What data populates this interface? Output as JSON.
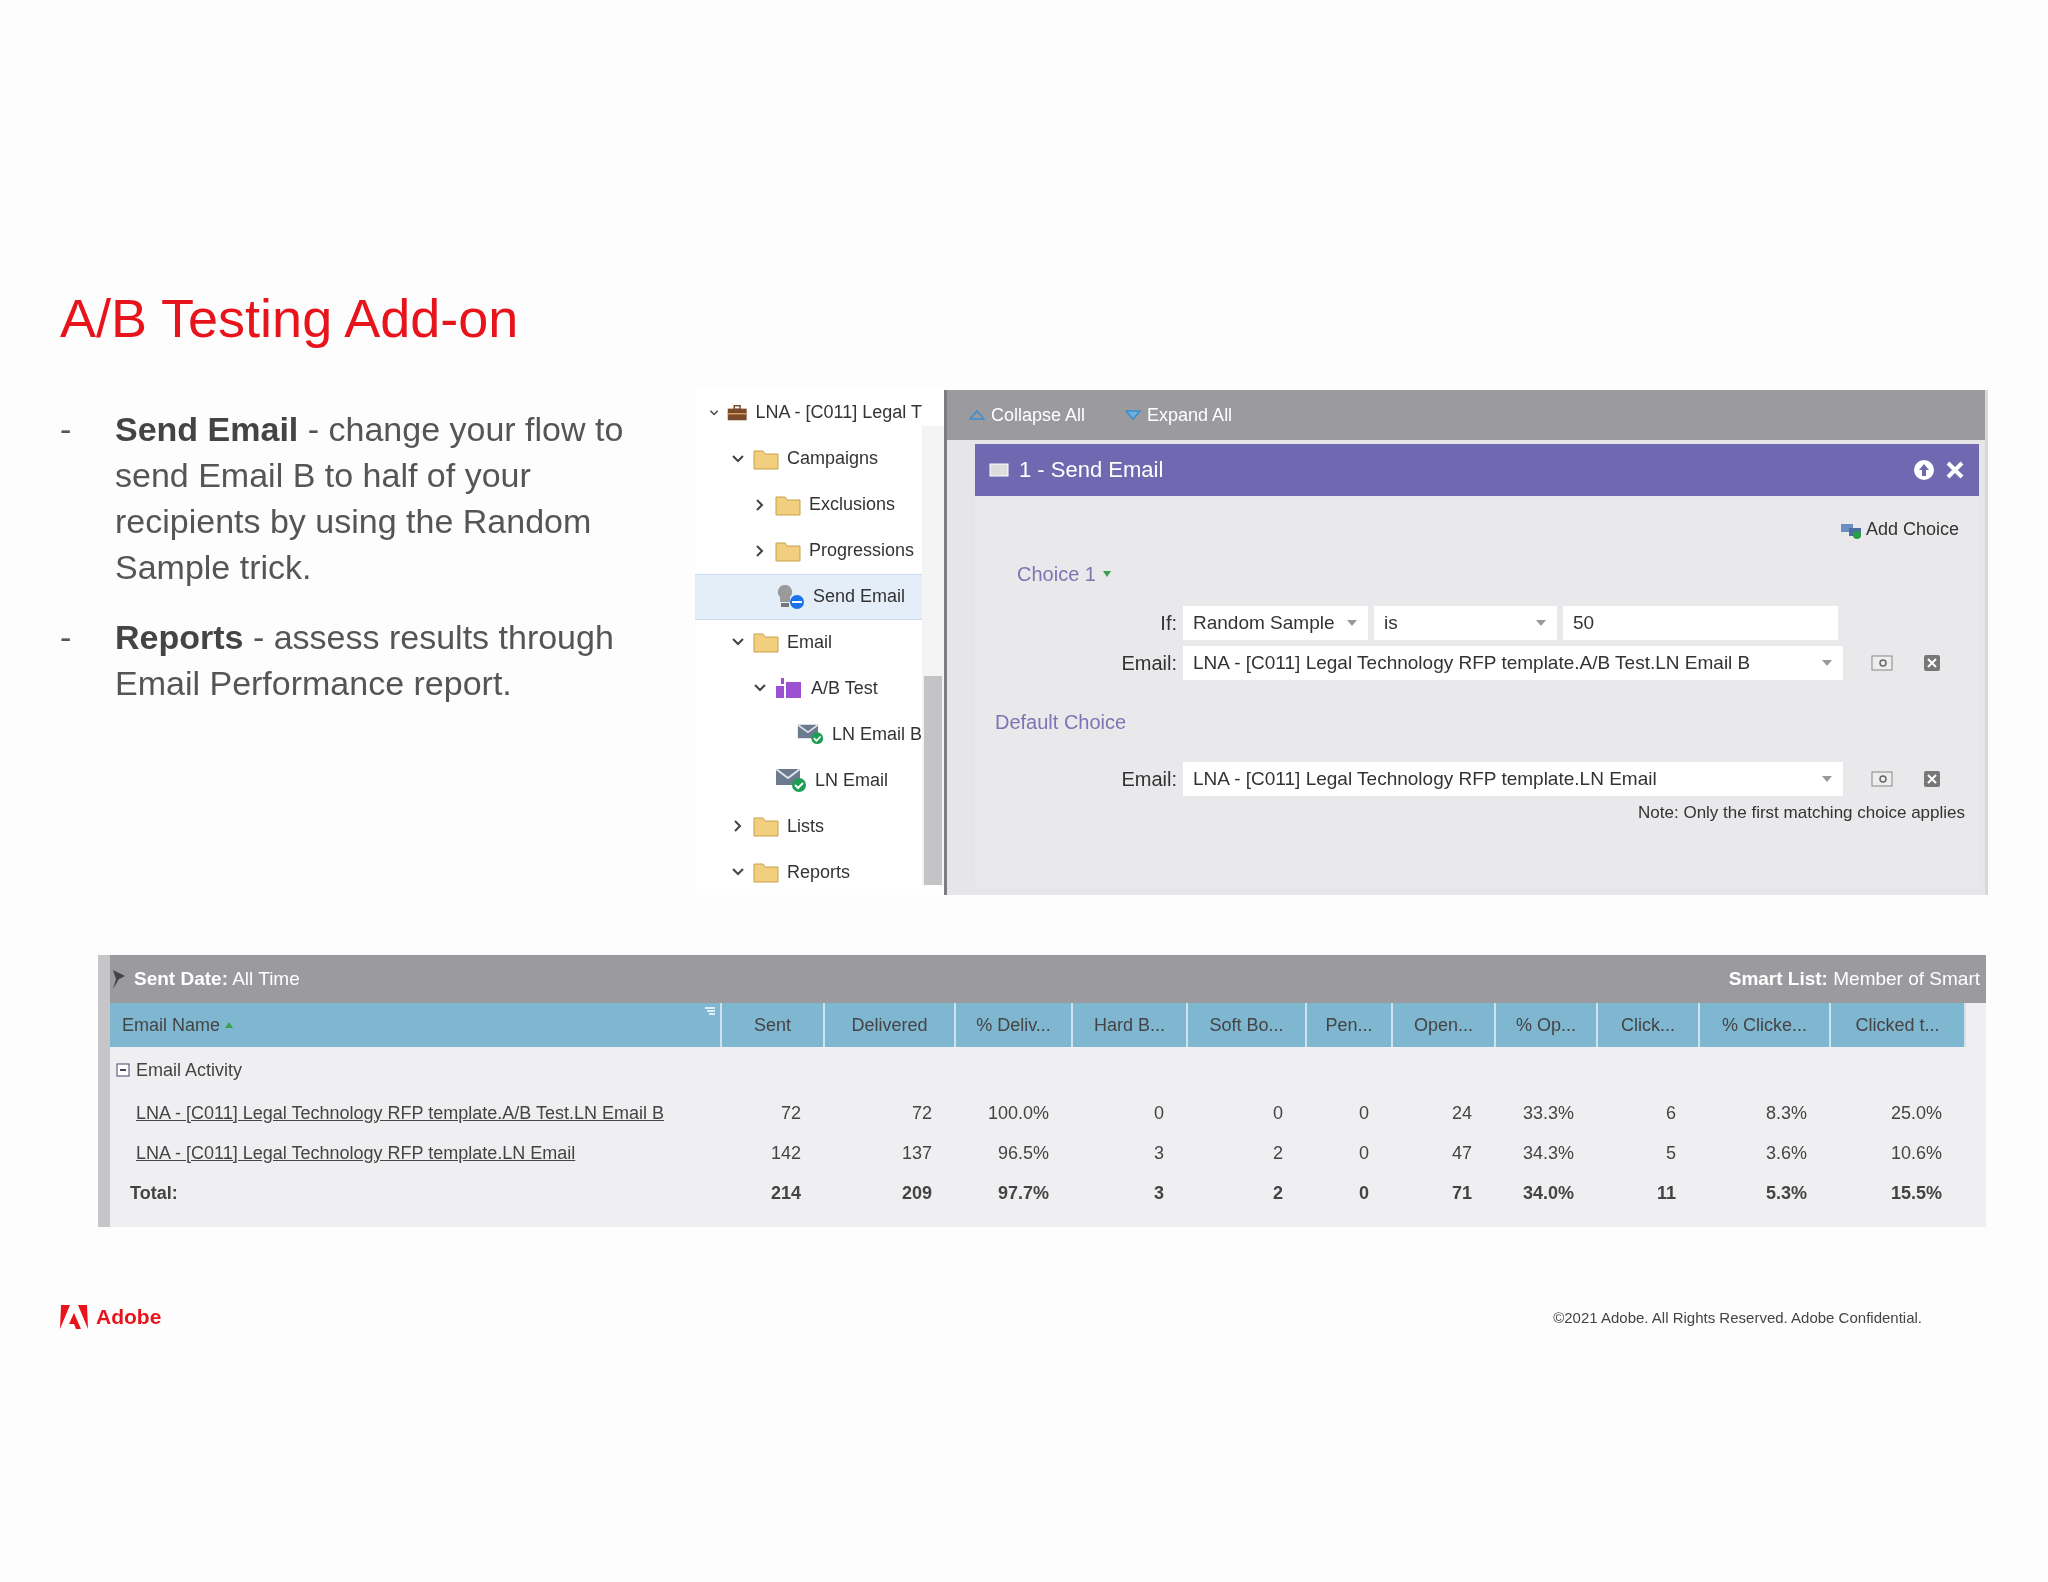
{
  "title": "A/B Testing Add-on",
  "bullets": [
    {
      "marker": "-",
      "text": "**Send Email** - change your flow to send Email B to half of your recipients by using the Random Sample trick."
    },
    {
      "marker": "-",
      "text": "**Reports** - assess results through Email Performance report."
    }
  ],
  "tree": [
    {
      "label": "LNA - [C011] Legal T",
      "kind": "program",
      "expanded": true,
      "selected": false,
      "children": [
        {
          "label": "Campaigns",
          "kind": "folder",
          "expanded": true,
          "selected": false,
          "children": [
            {
              "label": "Exclusions",
              "kind": "folder",
              "expanded": false,
              "selected": false
            },
            {
              "label": "Progressions",
              "kind": "folder",
              "expanded": false,
              "selected": false
            },
            {
              "label": "Send Email",
              "kind": "campaign",
              "selected": true
            }
          ]
        },
        {
          "label": "Email",
          "kind": "folder",
          "expanded": true,
          "selected": false,
          "children": [
            {
              "label": "A/B Test",
              "kind": "abtest",
              "expanded": true,
              "selected": false,
              "children": [
                {
                  "label": "LN Email B",
                  "kind": "email",
                  "selected": false
                }
              ]
            },
            {
              "label": "LN Email",
              "kind": "email",
              "selected": false
            }
          ]
        },
        {
          "label": "Lists",
          "kind": "folder",
          "expanded": false,
          "selected": false
        },
        {
          "label": "Reports",
          "kind": "folder",
          "expanded": true,
          "selected": false
        }
      ]
    }
  ],
  "flow": {
    "toolbar": [
      "Collapse All",
      "Expand All"
    ],
    "step_title": "1 - Send Email",
    "add_choice": "Add Choice",
    "choice_label": "Choice 1",
    "if_label": "If:",
    "condition": {
      "field": "Random Sample",
      "operator": "is",
      "value": "50"
    },
    "email_label": "Email:",
    "choice_email": "LNA - [C011] Legal Technology RFP template.A/B Test.LN Email B",
    "default_label": "Default Choice",
    "default_email_label": "Email:",
    "default_email": "LNA - [C011] Legal Technology RFP template.LN Email",
    "note": "Note: Only the first matching choice applies"
  },
  "report": {
    "filter_left": "**Sent Date:** All Time",
    "filter_right": "**Smart List:** Member of Smart",
    "columns": [
      "Email Name",
      "Sent",
      "Delivered",
      "% Deliv...",
      "Hard B...",
      "Soft Bo...",
      "Pen...",
      "Open...",
      "% Op...",
      "Click...",
      "% Clicke...",
      "Clicked t..."
    ],
    "group": "Email Activity",
    "rows": [
      [
        "LNA - [C011] Legal Technology RFP template.A/B Test.LN Email B",
        "72",
        "72",
        "100.0%",
        "0",
        "0",
        "0",
        "24",
        "33.3%",
        "6",
        "8.3%",
        "25.0%"
      ],
      [
        "LNA - [C011] Legal Technology RFP template.LN Email",
        "142",
        "137",
        "96.5%",
        "3",
        "2",
        "0",
        "47",
        "34.3%",
        "5",
        "3.6%",
        "10.6%"
      ]
    ],
    "total": [
      "Total:",
      "214",
      "209",
      "97.7%",
      "3",
      "2",
      "0",
      "71",
      "34.0%",
      "11",
      "5.3%",
      "15.5%"
    ]
  },
  "footer": {
    "brand": "Adobe",
    "copyright": "©2021 Adobe. All Rights Reserved. Adobe Confidential."
  }
}
